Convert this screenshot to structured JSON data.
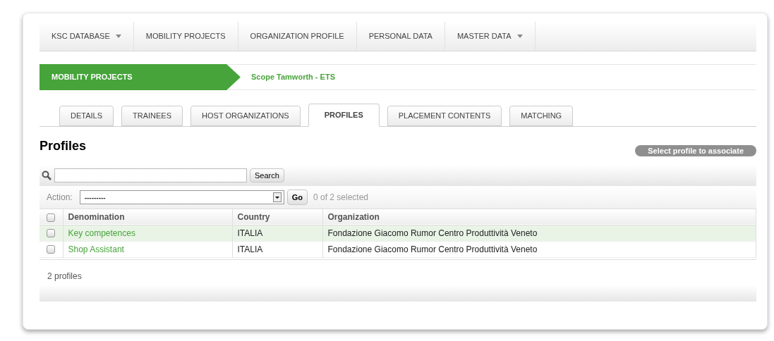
{
  "nav": [
    {
      "label": "KSC DATABASE",
      "dropdown": true
    },
    {
      "label": "MOBILITY PROJECTS",
      "dropdown": false
    },
    {
      "label": "ORGANIZATION PROFILE",
      "dropdown": false
    },
    {
      "label": "PERSONAL DATA",
      "dropdown": false
    },
    {
      "label": "MASTER DATA",
      "dropdown": true
    }
  ],
  "breadcrumb": {
    "section": "MOBILITY PROJECTS",
    "current": "Scope Tamworth - ETS"
  },
  "tabs": [
    {
      "label": "DETAILS",
      "selected": false
    },
    {
      "label": "TRAINEES",
      "selected": false
    },
    {
      "label": "HOST ORGANIZATIONS",
      "selected": false
    },
    {
      "label": "PROFILES",
      "selected": true
    },
    {
      "label": "PLACEMENT CONTENTS",
      "selected": false
    },
    {
      "label": "MATCHING",
      "selected": false
    }
  ],
  "heading": "Profiles",
  "associate_button": "Select profile to associate",
  "search": {
    "button": "Search"
  },
  "actions": {
    "label": "Action:",
    "value": "---------",
    "go": "Go",
    "counter": "0 of 2 selected"
  },
  "table": {
    "columns": [
      "Denomination",
      "Country",
      "Organization"
    ],
    "select_all": false,
    "rows": [
      {
        "cells": [
          "Key competences",
          "ITALIA",
          "Fondazione Giacomo Rumor Centro Produttività Veneto"
        ],
        "checked": false,
        "highlighted": true
      },
      {
        "cells": [
          "Shop Assistant",
          "ITALIA",
          "Fondazione Giacomo Rumor Centro Produttività Veneto"
        ],
        "checked": false,
        "highlighted": false
      }
    ]
  },
  "footer": "2 profiles"
}
